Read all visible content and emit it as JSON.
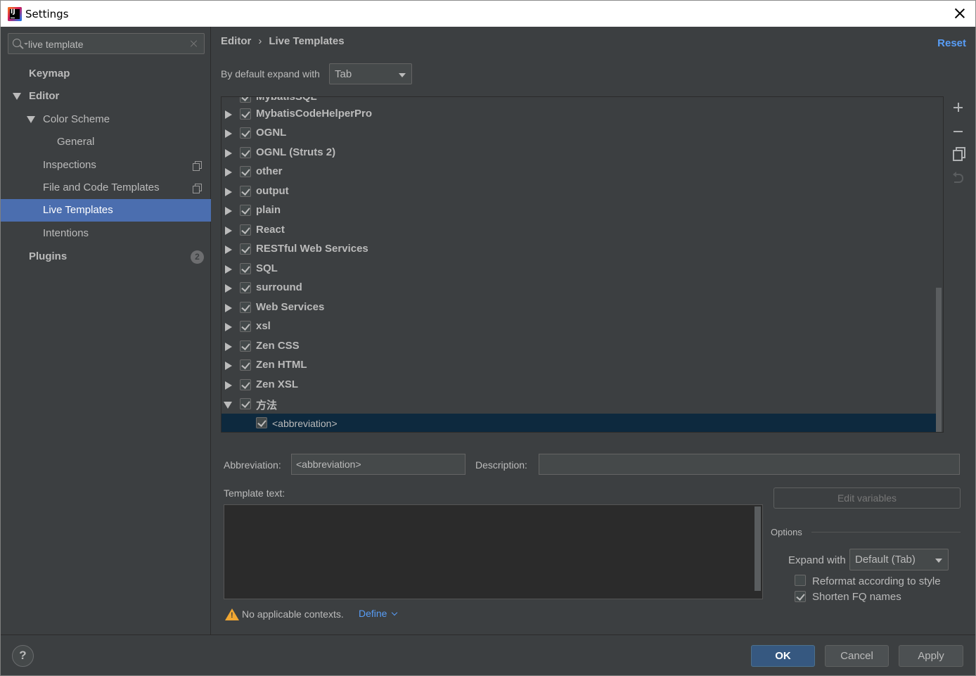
{
  "window": {
    "title": "Settings"
  },
  "sidebar": {
    "search": {
      "value": "live template",
      "placeholder": ""
    },
    "items": [
      {
        "label": "Keymap",
        "badge": ""
      },
      {
        "label": "Editor",
        "badge": ""
      },
      {
        "label": "Color Scheme",
        "badge": ""
      },
      {
        "label": "General",
        "badge": ""
      },
      {
        "label": "Inspections",
        "badge": ""
      },
      {
        "label": "File and Code Templates",
        "badge": ""
      },
      {
        "label": "Live Templates",
        "badge": ""
      },
      {
        "label": "Intentions",
        "badge": ""
      },
      {
        "label": "Plugins",
        "badge": "2"
      }
    ],
    "selected": "Live Templates"
  },
  "header": {
    "breadcrumb": [
      "Editor",
      "Live Templates"
    ],
    "separator": "›",
    "reset": "Reset"
  },
  "expand": {
    "label": "By default expand with",
    "value": "Tab"
  },
  "tree": {
    "partial_top": "MybatisSQL",
    "groups": [
      {
        "name": "MybatisCodeHelperPro",
        "checked": true,
        "expanded": false
      },
      {
        "name": "OGNL",
        "checked": true,
        "expanded": false
      },
      {
        "name": "OGNL (Struts 2)",
        "checked": true,
        "expanded": false
      },
      {
        "name": "other",
        "checked": true,
        "expanded": false
      },
      {
        "name": "output",
        "checked": true,
        "expanded": false
      },
      {
        "name": "plain",
        "checked": true,
        "expanded": false
      },
      {
        "name": "React",
        "checked": true,
        "expanded": false
      },
      {
        "name": "RESTful Web Services",
        "checked": true,
        "expanded": false
      },
      {
        "name": "SQL",
        "checked": true,
        "expanded": false
      },
      {
        "name": "surround",
        "checked": true,
        "expanded": false
      },
      {
        "name": "Web Services",
        "checked": true,
        "expanded": false
      },
      {
        "name": "xsl",
        "checked": true,
        "expanded": false
      },
      {
        "name": "Zen CSS",
        "checked": true,
        "expanded": false
      },
      {
        "name": "Zen HTML",
        "checked": true,
        "expanded": false
      },
      {
        "name": "Zen XSL",
        "checked": true,
        "expanded": false
      },
      {
        "name": "方法",
        "checked": true,
        "expanded": true
      }
    ],
    "child": {
      "name": "<abbreviation>",
      "checked": true,
      "selected": true
    }
  },
  "editor": {
    "abbreviation_label": "Abbreviation:",
    "abbreviation_value": "<abbreviation>",
    "description_label": "Description:",
    "description_value": "",
    "template_text_label": "Template text:",
    "template_text_value": "",
    "edit_variables": "Edit variables",
    "options_title": "Options",
    "expand_with_label": "Expand with",
    "expand_with_value": "Default (Tab)",
    "reformat_label": "Reformat according to style",
    "reformat_checked": false,
    "shorten_label": "Shorten FQ names",
    "shorten_checked": true,
    "warning": "No applicable contexts.",
    "define": "Define"
  },
  "footer": {
    "help": "?",
    "ok": "OK",
    "cancel": "Cancel",
    "apply": "Apply"
  },
  "colors": {
    "accent": "#4b6eaf",
    "link": "#589df6",
    "background": "#3c3f41",
    "selection_dark": "#0d293e",
    "warning": "#f0a732"
  }
}
